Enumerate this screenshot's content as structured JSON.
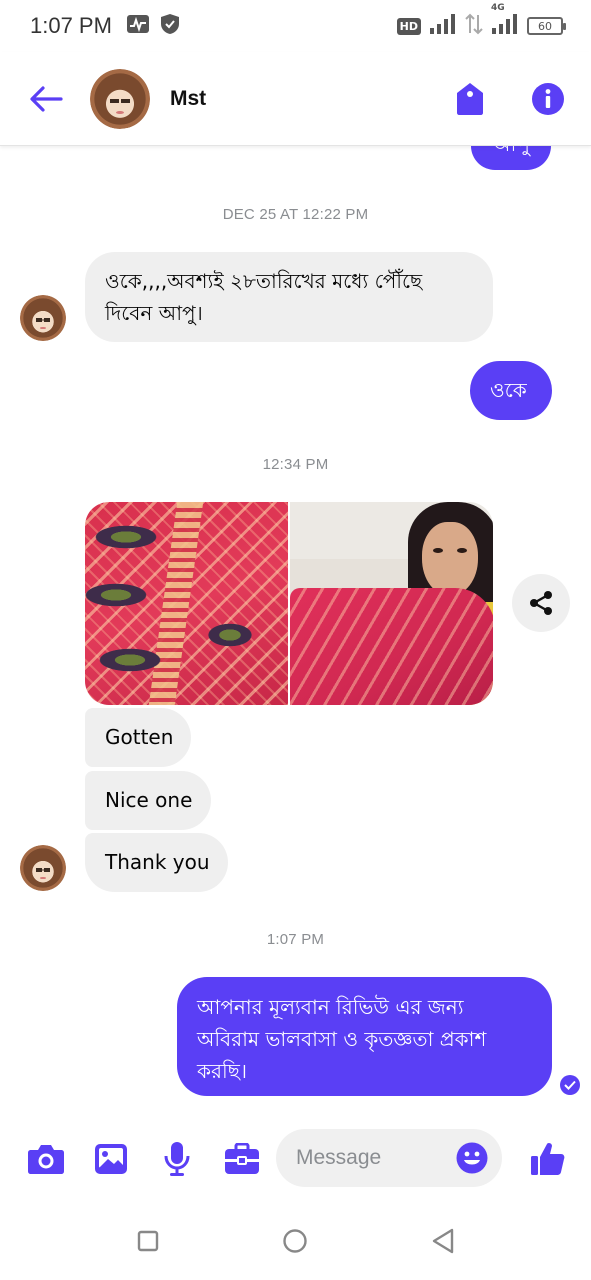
{
  "status_bar": {
    "time": "1:07 PM",
    "hd_label": "HD",
    "network_label": "4G",
    "battery": "60"
  },
  "header": {
    "contact_name": "Mst",
    "icons": [
      "back-arrow-icon",
      "tag-icon",
      "info-icon"
    ]
  },
  "messages": [
    {
      "type": "timestamp",
      "text": "DEC 25 AT 12:22 PM"
    },
    {
      "type": "incoming",
      "lines": [
        "ওকে,,,,অবশ্যই ২৮তারিখের মধ্যে পৌঁছে",
        "দিবেন আপু।"
      ]
    },
    {
      "type": "outgoing",
      "text": "ওকে"
    },
    {
      "type": "timestamp",
      "text": "12:34 PM"
    },
    {
      "type": "incoming",
      "text": "Gotten"
    },
    {
      "type": "incoming",
      "text": "Nice one"
    },
    {
      "type": "incoming",
      "text": "Thank you"
    },
    {
      "type": "timestamp",
      "text": "1:07 PM"
    },
    {
      "type": "outgoing",
      "lines": [
        "আপনার মূল্যবান রিভিউ এর জন্য",
        "অবিরাম ভালবাসা ও কৃতজ্ঞতা প্রকাশ",
        "করছি।"
      ]
    }
  ],
  "top_partial_bubble": "আপু",
  "composer": {
    "placeholder": "Message",
    "icons": [
      "camera-icon",
      "gallery-icon",
      "microphone-icon",
      "briefcase-icon",
      "emoji-icon",
      "thumbs-up-icon"
    ]
  },
  "colors": {
    "accent": "#5a3ff5",
    "incoming_bubble": "#efefef",
    "timestamp": "#8a8d91"
  }
}
